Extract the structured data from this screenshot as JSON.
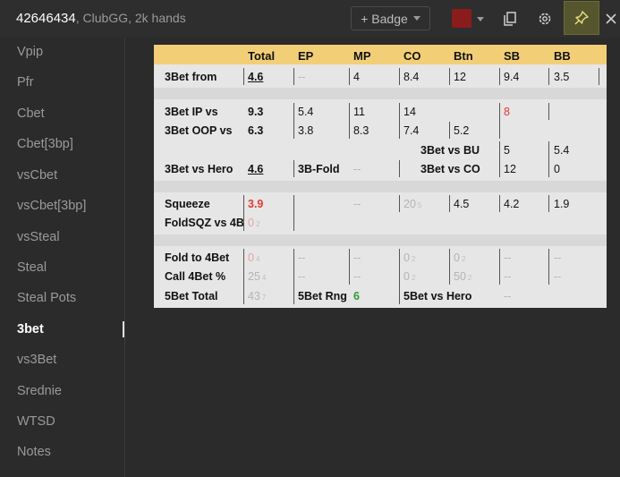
{
  "header": {
    "player_id": "42646434",
    "player_meta": ", ClubGG, 2k hands",
    "badge_label": "+ Badge",
    "swatch_color": "#8b1c1c",
    "copy_icon": "copy-icon",
    "gear_icon": "gear-icon",
    "pin_icon": "pin-icon",
    "close_icon": "close-icon"
  },
  "sidebar": {
    "items": [
      {
        "label": "Vpip"
      },
      {
        "label": "Pfr"
      },
      {
        "label": "Cbet"
      },
      {
        "label": "Cbet[3bp]"
      },
      {
        "label": "vsCbet"
      },
      {
        "label": "vsCbet[3bp]"
      },
      {
        "label": "vsSteal"
      },
      {
        "label": "Steal"
      },
      {
        "label": "Steal Pots"
      },
      {
        "label": "3bet"
      },
      {
        "label": "vs3Bet"
      },
      {
        "label": "Srednie"
      },
      {
        "label": "WTSD"
      },
      {
        "label": "Notes"
      }
    ],
    "active": "3bet"
  },
  "table": {
    "colors": {
      "header_band": "#f2cf77",
      "red": "#e53935",
      "green": "#2e9c2e"
    },
    "headers": [
      "Total",
      "EP",
      "MP",
      "CO",
      "Btn",
      "SB",
      "BB"
    ],
    "rows": {
      "bet3_from": {
        "label": "3Bet from",
        "total": "4.6",
        "ep": "--",
        "mp": "4",
        "co": "8.4",
        "btn": "12",
        "sb": "9.4",
        "bb": "3.5"
      },
      "bet3_ip": {
        "label": "3Bet IP vs",
        "total": "9.3",
        "ep": "5.4",
        "mp": "11",
        "co": "14",
        "sb": "8"
      },
      "bet3_oop": {
        "label": "3Bet OOP vs",
        "total": "6.3",
        "ep": "3.8",
        "mp": "8.3",
        "co": "7.4",
        "btn": "5.2"
      },
      "bet3_vs_bu": {
        "label": "3Bet vs BU",
        "sb": "5",
        "bb": "5.4"
      },
      "bet3_vs_hero": {
        "label": "3Bet vs Hero",
        "total": "4.6",
        "fold_label": "3B-Fold",
        "fold_val": "--",
        "vs_co_label": "3Bet vs CO",
        "sb": "12",
        "bb": "0"
      },
      "squeeze": {
        "label": "Squeeze",
        "total": "3.9",
        "mp": "--",
        "co": "20",
        "co_sup": "5",
        "btn": "4.5",
        "sb": "4.2",
        "bb": "1.9"
      },
      "foldsqz": {
        "label": "FoldSQZ vs 4B",
        "total": "0",
        "total_sup": "2"
      },
      "fold_4bet": {
        "label": "Fold to 4Bet",
        "total": "0",
        "total_sup": "4",
        "ep": "--",
        "mp": "--",
        "co": "0",
        "co_sup": "2",
        "btn": "0",
        "btn_sup": "2",
        "sb": "--",
        "bb": "--"
      },
      "call_4bet": {
        "label": "Call 4Bet %",
        "total": "25",
        "total_sup": "4",
        "ep": "--",
        "mp": "--",
        "co": "0",
        "co_sup": "2",
        "btn": "50",
        "btn_sup": "2",
        "sb": "--",
        "bb": "--"
      },
      "bet5_total": {
        "label": "5Bet Total",
        "total": "43",
        "total_sup": "7",
        "rng_label": "5Bet Rng",
        "rng_val": "6",
        "vs_hero_label": "5Bet vs Hero",
        "vs_hero_val": "--"
      }
    }
  }
}
